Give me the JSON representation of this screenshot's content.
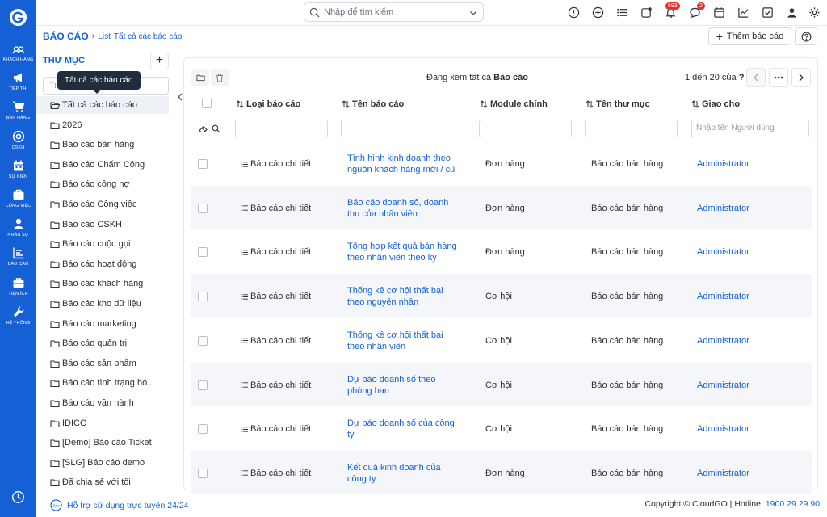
{
  "rail": {
    "items": [
      {
        "label": "KHÁCH HÀNG",
        "icon": "users-icon"
      },
      {
        "label": "TIẾP THỊ",
        "icon": "megaphone-icon"
      },
      {
        "label": "BÁN HÀNG",
        "icon": "cart-icon"
      },
      {
        "label": "CSKH",
        "icon": "support-icon"
      },
      {
        "label": "SỰ KIỆN",
        "icon": "calendar-icon"
      },
      {
        "label": "CÔNG VIỆC",
        "icon": "briefcase-icon"
      },
      {
        "label": "NHÂN SỰ",
        "icon": "person-icon"
      },
      {
        "label": "BÁO CÁO",
        "icon": "report-icon"
      },
      {
        "label": "TIỆN ÍCH",
        "icon": "toolbox-icon"
      },
      {
        "label": "HỆ THỐNG",
        "icon": "wrench-icon"
      }
    ]
  },
  "topbar": {
    "search_placeholder": "Nhập để tìm kiếm",
    "notifications_badge": "693",
    "messages_badge": "2"
  },
  "breadcrumb": {
    "root": "BÁO CÁO",
    "level1": "List",
    "level2": "Tất cả các báo cáo"
  },
  "actions": {
    "add_label": "Thêm báo cáo"
  },
  "folders": {
    "title": "THƯ MỤC",
    "search_placeholder": "Ti",
    "tooltip": "Tất cả các báo cáo",
    "items": [
      "Tất cả các báo cáo",
      "2026",
      "Báo cáo bán hàng",
      "Báo cáo Chấm Công",
      "Báo cáo công nợ",
      "Báo cáo Công việc",
      "Báo cáo CSKH",
      "Báo cáo cuộc gọi",
      "Báo cáo hoạt động",
      "Báo cáo khách hàng",
      "Báo cáo kho dữ liệu",
      "Báo cáo marketing",
      "Báo cáo quản trị",
      "Báo cáo sản phẩm",
      "Báo cáo tình trạng ho...",
      "Báo cáo vận hành",
      "IDICO",
      "[Demo] Báo cáo Ticket",
      "[SLG] Báo cáo demo",
      "Đã chia sẻ với tôi"
    ]
  },
  "list": {
    "viewing_prefix": "Đang xem tất cả",
    "viewing_module": "Báo cáo",
    "pagination": "1 đến 20 của",
    "pagination_help": "?",
    "columns": [
      "Loại báo cáo",
      "Tên báo cáo",
      "Module chính",
      "Tên thư mục",
      "Giao cho"
    ],
    "assignee_filter_placeholder": "Nhập tên Người dùng",
    "rows": [
      {
        "type": "Báo cáo chi tiết",
        "name1": "Tình hình kinh doanh theo",
        "name2": "nguồn khách hàng mới / cũ",
        "module": "Đơn hàng",
        "folder": "Báo cáo bán hàng",
        "assignee": "Administrator"
      },
      {
        "type": "Báo cáo chi tiết",
        "name1": "Báo cáo doanh số, doanh",
        "name2": "thu của nhân viên",
        "module": "Đơn hàng",
        "folder": "Báo cáo bán hàng",
        "assignee": "Administrator"
      },
      {
        "type": "Báo cáo chi tiết",
        "name1": "Tổng hợp kết quả bán hàng",
        "name2": "theo nhân viên theo kỳ",
        "module": "Đơn hàng",
        "folder": "Báo cáo bán hàng",
        "assignee": "Administrator"
      },
      {
        "type": "Báo cáo chi tiết",
        "name1": "Thống kê cơ hội thất bại",
        "name2": "theo nguyên nhân",
        "module": "Cơ hội",
        "folder": "Báo cáo bán hàng",
        "assignee": "Administrator"
      },
      {
        "type": "Báo cáo chi tiết",
        "name1": "Thống kê cơ hội thất bại",
        "name2": "theo nhân viên",
        "module": "Cơ hội",
        "folder": "Báo cáo bán hàng",
        "assignee": "Administrator"
      },
      {
        "type": "Báo cáo chi tiết",
        "name1": "Dự báo doanh số theo",
        "name2": "phòng ban",
        "module": "Cơ hội",
        "folder": "Báo cáo bán hàng",
        "assignee": "Administrator"
      },
      {
        "type": "Báo cáo chi tiết",
        "name1": "Dự báo doanh số của công",
        "name2": "ty",
        "module": "Cơ hội",
        "folder": "Báo cáo bán hàng",
        "assignee": "Administrator"
      },
      {
        "type": "Báo cáo chi tiết",
        "name1": "Kết quả kinh doanh của",
        "name2": "công ty",
        "module": "Đơn hàng",
        "folder": "Báo cáo bán hàng",
        "assignee": "Administrator"
      }
    ]
  },
  "footer": {
    "support": "Hỗ trợ sử dụng trực tuyến 24/24",
    "zalo": "Zalo",
    "copyright": "Copyright © CloudGO",
    "hotline_label": "Hotline:",
    "hotline": "1900 29 29 90"
  },
  "colors": {
    "brand": "#1560d4",
    "badge": "#e0322d"
  }
}
